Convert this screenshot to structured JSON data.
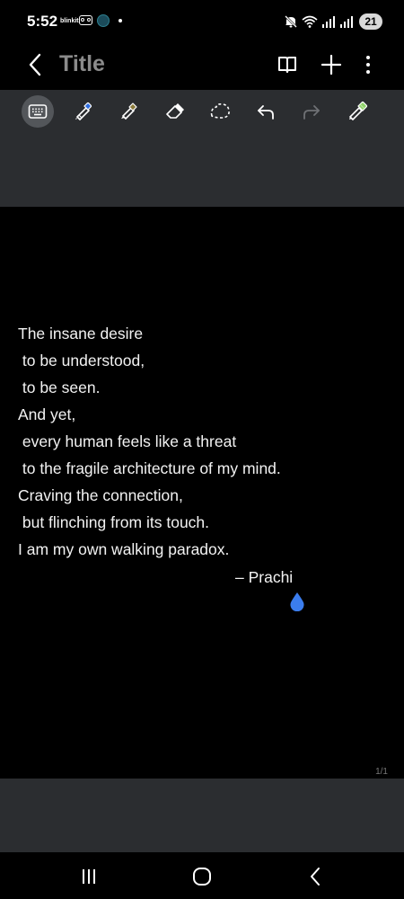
{
  "status_bar": {
    "time": "5:52",
    "app_label": "blinkit",
    "battery": "21",
    "icons": [
      "voicemail-icon",
      "globe-icon",
      "notification-dot",
      "mute-icon",
      "wifi-icon",
      "signal-icon",
      "signal-icon",
      "battery-badge"
    ]
  },
  "app_bar": {
    "title": "Title",
    "icons": [
      "back-icon",
      "book-icon",
      "add-icon",
      "more-icon"
    ]
  },
  "toolbar": {
    "tools": [
      "keyboard-icon",
      "pen-icon",
      "highlighter-icon",
      "eraser-icon",
      "lasso-icon",
      "undo-icon",
      "redo-icon",
      "pen-settings-icon"
    ],
    "active_tool": "keyboard-icon",
    "colors": {
      "pen_blue": "#2f6ee0",
      "highlighter": "#8a7a3a",
      "pen_settings": "#8fd16a"
    }
  },
  "note": {
    "lines": [
      "The insane desire",
      " to be understood,",
      " to be seen.",
      "And yet,",
      " every human feels like a threat",
      " to the fragile architecture of my mind.",
      "Craving the connection,",
      " but flinching from its touch.",
      "I am my own walking paradox."
    ],
    "signature": "– Prachi",
    "page_indicator": "1/1",
    "cursor_color": "#3b7ded"
  },
  "nav_bar": {
    "icons": [
      "recent-apps-icon",
      "home-icon",
      "back-nav-icon"
    ]
  }
}
